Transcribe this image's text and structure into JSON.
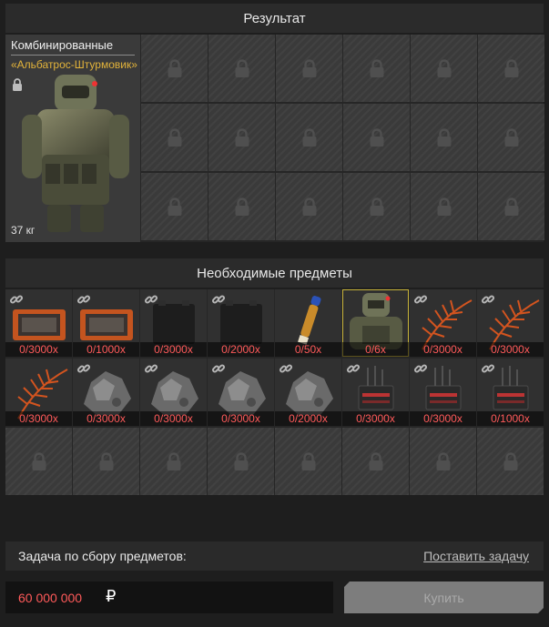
{
  "result_section": {
    "title": "Результат",
    "item": {
      "name": "Комбинированные",
      "subtitle": "«Альбатрос-Штурмовик»",
      "weight": "37 кг"
    },
    "locked_slots": 18
  },
  "required_section": {
    "title": "Необходимые предметы",
    "items": [
      {
        "icon": "orange-case-icon",
        "count": "0/3000x",
        "linked": true
      },
      {
        "icon": "orange-case-icon",
        "count": "0/1000x",
        "linked": true
      },
      {
        "icon": "black-battery-icon",
        "count": "0/3000x",
        "linked": true
      },
      {
        "icon": "black-battery-icon",
        "count": "0/2000x",
        "linked": true
      },
      {
        "icon": "syringe-vial-icon",
        "count": "0/50x",
        "linked": false
      },
      {
        "icon": "armor-suit-icon",
        "count": "0/6x",
        "linked": false
      },
      {
        "icon": "orange-fern-icon",
        "count": "0/3000x",
        "linked": true
      },
      {
        "icon": "orange-fern-icon",
        "count": "0/3000x",
        "linked": true
      },
      {
        "icon": "orange-fern-icon",
        "count": "0/3000x",
        "linked": false
      },
      {
        "icon": "gray-ore-icon",
        "count": "0/3000x",
        "linked": true
      },
      {
        "icon": "gray-ore-icon",
        "count": "0/3000x",
        "linked": true
      },
      {
        "icon": "gray-ore-icon",
        "count": "0/3000x",
        "linked": true
      },
      {
        "icon": "gray-ore-icon",
        "count": "0/2000x",
        "linked": true
      },
      {
        "icon": "circuit-device-icon",
        "count": "0/3000x",
        "linked": true
      },
      {
        "icon": "circuit-device-icon",
        "count": "0/3000x",
        "linked": true
      },
      {
        "icon": "circuit-device-icon",
        "count": "0/1000x",
        "linked": true
      }
    ],
    "locked_slots": 8
  },
  "task": {
    "label": "Задача по сбору предметов:",
    "action": "Поставить задачу"
  },
  "price": {
    "value": "60 000 000",
    "currency": "₽"
  },
  "buy_button": "Купить",
  "colors": {
    "count_red": "#ff5a5a",
    "subtitle_gold": "#e2b33a",
    "highlight": "#c8b43a"
  }
}
